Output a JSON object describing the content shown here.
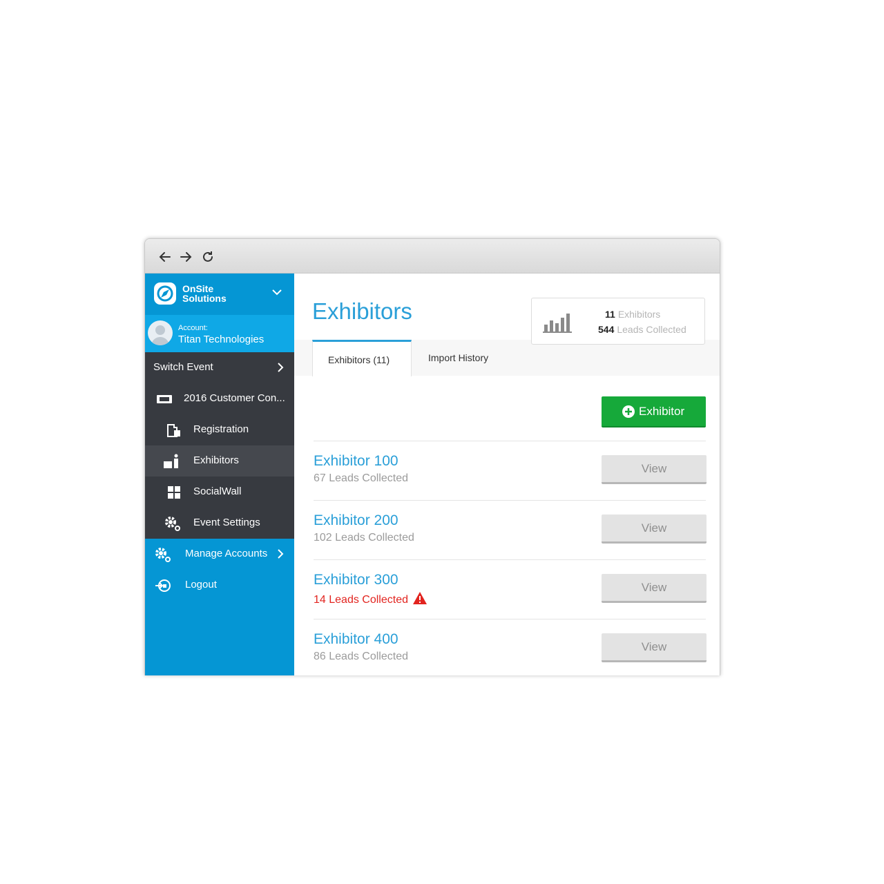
{
  "brand": {
    "name_line1": "OnSite",
    "name_line2": "Solutions"
  },
  "account": {
    "label": "Account:",
    "name": "Titan Technologies"
  },
  "sidebar": {
    "switch_event": "Switch Event",
    "event_name": "2016 Customer Con...",
    "items": [
      {
        "label": "Registration",
        "icon": "registration-icon"
      },
      {
        "label": "Exhibitors",
        "icon": "exhibitor-icon"
      },
      {
        "label": "SocialWall",
        "icon": "grid-icon"
      },
      {
        "label": "Event Settings",
        "icon": "gear-icon"
      }
    ],
    "manage_accounts": "Manage Accounts",
    "logout": "Logout"
  },
  "page": {
    "title": "Exhibitors"
  },
  "stats": {
    "exhibitors_count": "11",
    "exhibitors_label": "Exhibitors",
    "leads_count": "544",
    "leads_label": "Leads Collected"
  },
  "tabs": [
    {
      "label": "Exhibitors (11)"
    },
    {
      "label": "Import History"
    }
  ],
  "add_button": {
    "label": "Exhibitor"
  },
  "exhibitors": [
    {
      "name": "Exhibitor 100",
      "leads": "67 Leads Collected",
      "view": "View"
    },
    {
      "name": "Exhibitor 200",
      "leads": "102 Leads Collected",
      "view": "View"
    },
    {
      "name": "Exhibitor 300",
      "leads": "14 Leads Collected",
      "view": "View"
    },
    {
      "name": "Exhibitor 400",
      "leads": "86 Leads Collected",
      "view": "View"
    }
  ],
  "colors": {
    "sidebar_blue": "#0596d4",
    "sidebar_dark": "#373a40",
    "accent": "#2a9fd8",
    "success": "#16a93a",
    "warning": "#e2241f"
  }
}
